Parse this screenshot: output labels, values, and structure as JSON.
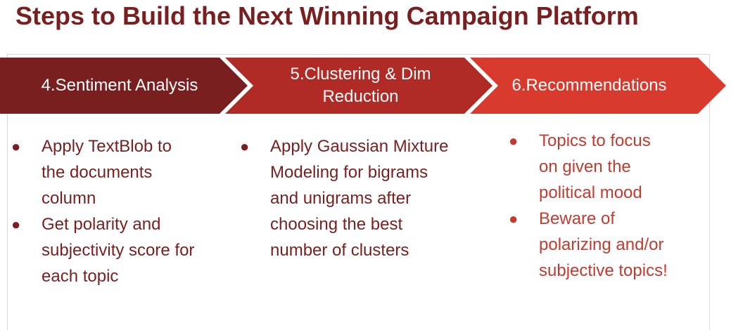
{
  "title": "Steps to Build the Next Winning Campaign Platform",
  "colors": {
    "title": "#7a1f1f",
    "step1": "#7a1f1f",
    "step2": "#b12b26",
    "step3": "#d93a2e",
    "text_dark": "#7a1f1f",
    "text_light": "#c33a2e"
  },
  "steps": [
    {
      "label_line1": "4.Sentiment Analysis",
      "label_line2": "",
      "bullets": [
        [
          "Apply TextBlob to",
          "the documents",
          "column"
        ],
        [
          "Get polarity and",
          "subjectivity score for",
          "each topic"
        ]
      ]
    },
    {
      "label_line1": "5.Clustering & Dim",
      "label_line2": "Reduction",
      "bullets": [
        [
          "Apply Gaussian Mixture",
          "Modeling for bigrams",
          "and unigrams after",
          "choosing the best",
          "number of clusters"
        ]
      ]
    },
    {
      "label_line1": "6.Recommendations",
      "label_line2": "",
      "bullets": [
        [
          "Topics to focus",
          "on given the",
          "political mood"
        ],
        [
          "Beware of",
          "polarizing and/or",
          "subjective topics!"
        ]
      ]
    }
  ]
}
